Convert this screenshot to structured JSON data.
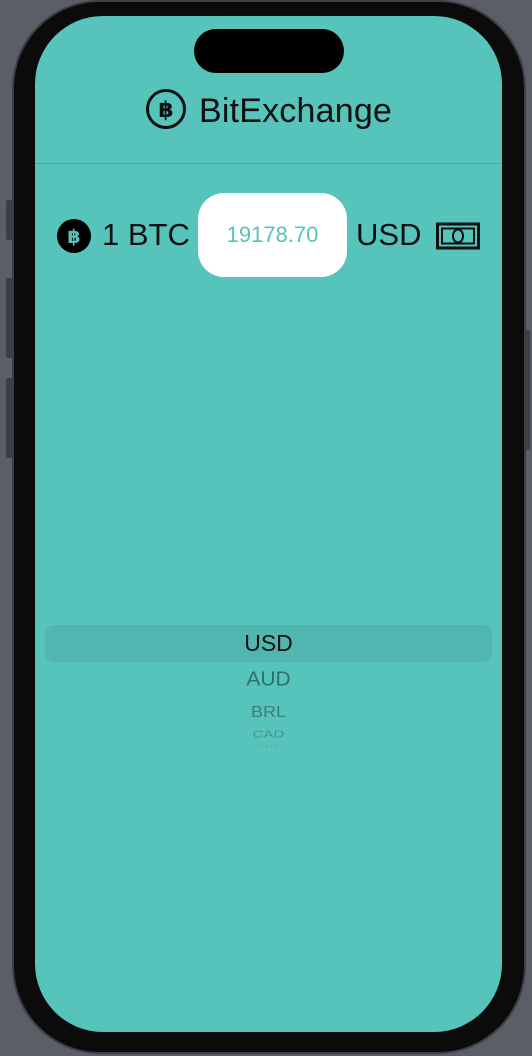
{
  "app": {
    "title": "BitExchange",
    "icon": "bitcoin-circle-icon"
  },
  "rate_row": {
    "amount_label": "1 BTC",
    "rate_value": "19178.70",
    "currency": "USD",
    "left_icon": "bitcoin-fill-icon",
    "right_icon": "banknote-icon"
  },
  "picker": {
    "selected": "USD",
    "options": [
      "USD",
      "AUD",
      "BRL",
      "CAD",
      "CNY"
    ]
  },
  "colors": {
    "background": "#57c4bc",
    "rate_box": "#ffffff",
    "text": "#111111"
  }
}
